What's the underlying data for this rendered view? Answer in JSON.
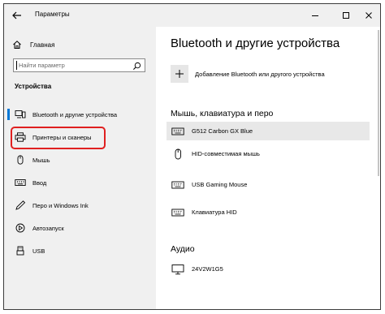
{
  "window": {
    "title": "Параметры",
    "controls": [
      "minimize-icon",
      "maximize-icon",
      "close-icon"
    ]
  },
  "sidebar": {
    "home_label": "Главная",
    "search_placeholder": "Найти параметр",
    "section_title": "Устройства",
    "items": [
      {
        "label": "Bluetooth и другие устройства",
        "icon": "bluetooth-devices-icon",
        "active": true
      },
      {
        "label": "Принтеры и сканеры",
        "icon": "printer-icon",
        "active": false
      },
      {
        "label": "Мышь",
        "icon": "mouse-icon",
        "active": false
      },
      {
        "label": "Ввод",
        "icon": "keyboard-icon",
        "active": false
      },
      {
        "label": "Перо и Windows Ink",
        "icon": "pen-icon",
        "active": false
      },
      {
        "label": "Автозапуск",
        "icon": "autoplay-icon",
        "active": false
      },
      {
        "label": "USB",
        "icon": "usb-icon",
        "active": false
      }
    ]
  },
  "main": {
    "title": "Bluetooth и другие устройства",
    "add_label": "Добавление Bluetooth или другого устройства",
    "mouse_section_title": "Мышь, клавиатура и перо",
    "devices": [
      {
        "label": "G512 Carbon GX Blue",
        "icon": "keyboard-icon",
        "selected": true
      },
      {
        "label": "HID-совместимая мышь",
        "icon": "mouse-icon",
        "selected": false
      },
      {
        "label": "USB Gaming Mouse",
        "icon": "keyboard-icon",
        "selected": false
      },
      {
        "label": "Клавиатура HID",
        "icon": "keyboard-icon",
        "selected": false
      }
    ],
    "audio_section_title": "Аудио",
    "audio_devices": [
      {
        "label": "24V2W1G5",
        "icon": "monitor-icon"
      }
    ]
  },
  "colors": {
    "accent": "#0078d7",
    "highlight": "#e02020",
    "sidebar_bg": "#f0f0f0"
  }
}
